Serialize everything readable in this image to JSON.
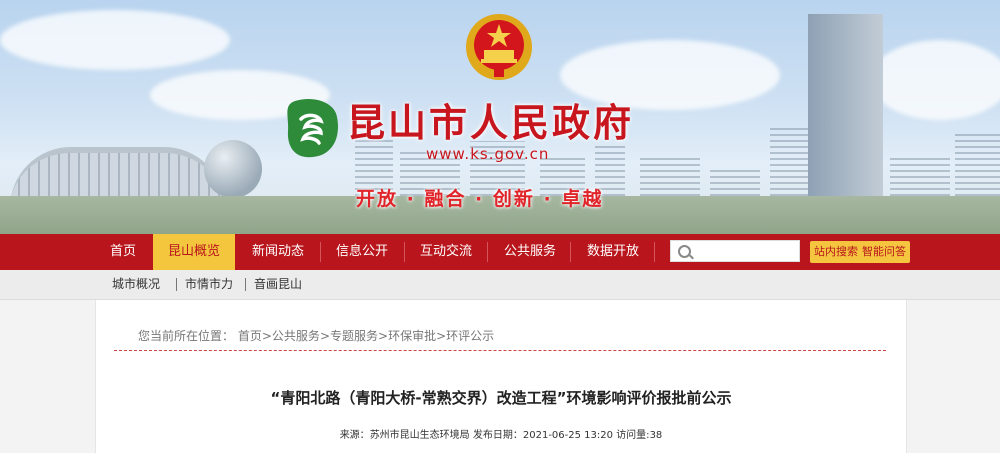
{
  "header": {
    "title": "昆山市人民政府",
    "url": "www.ks.gov.cn",
    "slogan": "开放 · 融合 · 创新 · 卓越"
  },
  "nav": {
    "items": [
      "首页",
      "昆山概览",
      "新闻动态",
      "信息公开",
      "互动交流",
      "公共服务",
      "数据开放"
    ],
    "active_index": 1,
    "site_search_button": "站内搜索",
    "smart_qa_button": "智能问答"
  },
  "subnav": {
    "items": [
      "城市概况",
      "市情市力",
      "音画昆山"
    ]
  },
  "breadcrumb": {
    "prefix": "您当前所在位置：",
    "items": [
      "首页",
      "公共服务",
      "专题服务",
      "环保审批",
      "环评公示"
    ],
    "separator": ">"
  },
  "article": {
    "title": "“青阳北路（青阳大桥-常熟交界）改造工程”环境影响评价报批前公示",
    "source_label": "来源：",
    "source": "苏州市昆山生态环境局",
    "date_label": "发布日期：",
    "date": "2021-06-25 13:20",
    "views_label": "访问量:",
    "views": "38"
  },
  "colors": {
    "nav_red": "#b8161c",
    "active_yellow": "#f3c63d",
    "title_red": "#c8161e"
  }
}
